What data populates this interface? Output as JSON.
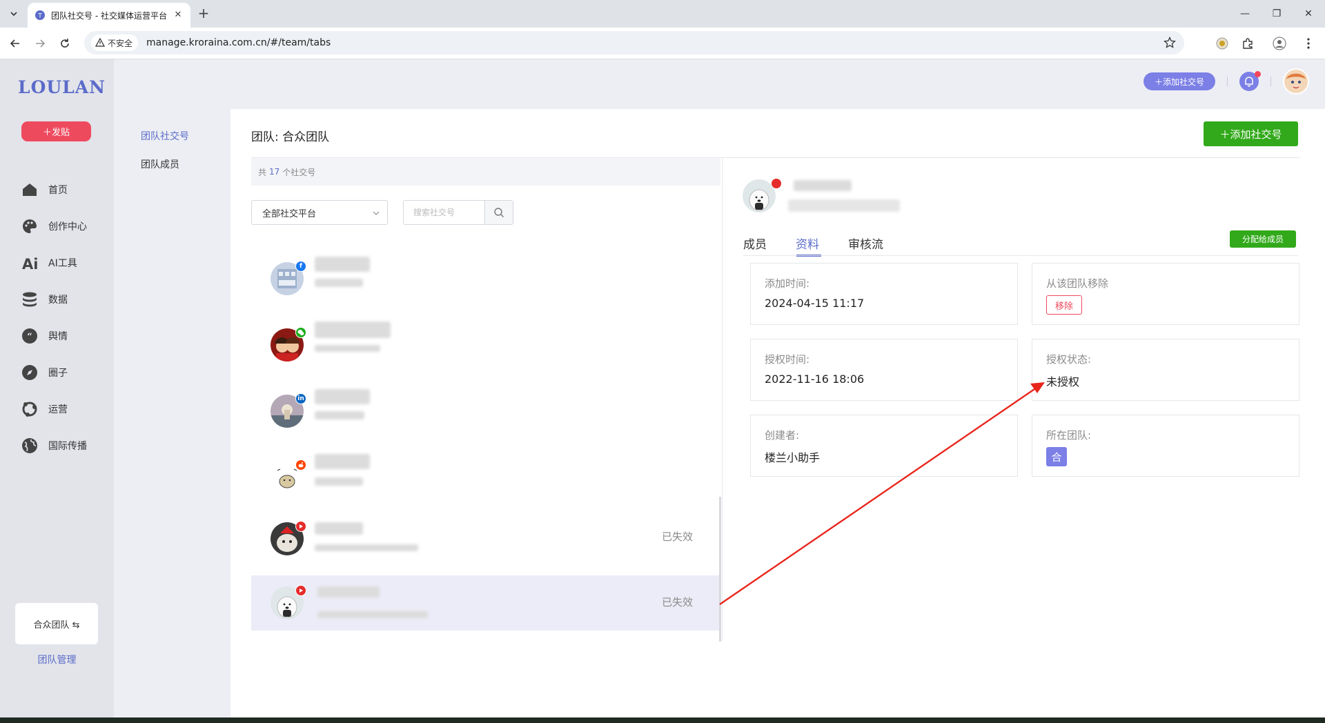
{
  "browser": {
    "tab_title": "团队社交号 - 社交媒体运营平台",
    "url": "manage.kroraina.com.cn/#/team/tabs",
    "security_label": "不安全"
  },
  "sidebar": {
    "logo": "LOULAN",
    "post_button": "＋发贴",
    "items": [
      {
        "label": "首页",
        "icon": "home-icon"
      },
      {
        "label": "创作中心",
        "icon": "palette-icon"
      },
      {
        "label": "AI工具",
        "icon": "ai-icon"
      },
      {
        "label": "数据",
        "icon": "database-icon"
      },
      {
        "label": "舆情",
        "icon": "quote-icon"
      },
      {
        "label": "圈子",
        "icon": "compass-icon"
      },
      {
        "label": "运营",
        "icon": "operations-icon"
      },
      {
        "label": "国际传播",
        "icon": "globe-icon"
      }
    ],
    "team_name": "合众团队 ⇆",
    "team_manage": "团队管理"
  },
  "header": {
    "add_account": "＋添加社交号"
  },
  "subnav": {
    "items": [
      "团队社交号",
      "团队成员"
    ]
  },
  "main": {
    "title": "团队: 合众团队",
    "add_button": "＋添加社交号",
    "count_prefix": "共",
    "count": "17",
    "count_suffix": "个社交号",
    "platform_select": "全部社交平台",
    "search_placeholder": "搜索社交号",
    "accounts": [
      {
        "platform": "facebook",
        "status": ""
      },
      {
        "platform": "wechat",
        "status": ""
      },
      {
        "platform": "linkedin",
        "status": ""
      },
      {
        "platform": "reddit",
        "status": ""
      },
      {
        "platform": "youtube",
        "status": "已失效"
      },
      {
        "platform": "youtube",
        "status": "已失效"
      }
    ]
  },
  "detail": {
    "tabs": [
      "成员",
      "资料",
      "审核流"
    ],
    "active_tab": "资料",
    "assign_button": "分配给成员",
    "cards": {
      "added_label": "添加时间:",
      "added_value": "2024-04-15 11:17",
      "remove_label": "从该团队移除",
      "remove_button": "移除",
      "auth_time_label": "授权时间:",
      "auth_time_value": "2022-11-16 18:06",
      "auth_status_label": "授权状态:",
      "auth_status_value": "未授权",
      "creator_label": "创建者:",
      "creator_value": "楼兰小助手",
      "team_label": "所在团队:",
      "team_chip": "合"
    }
  },
  "colors": {
    "accent": "#5b6bc9",
    "green": "#31a91a",
    "red": "#ee4a5e",
    "annotation": "#e8261c"
  }
}
